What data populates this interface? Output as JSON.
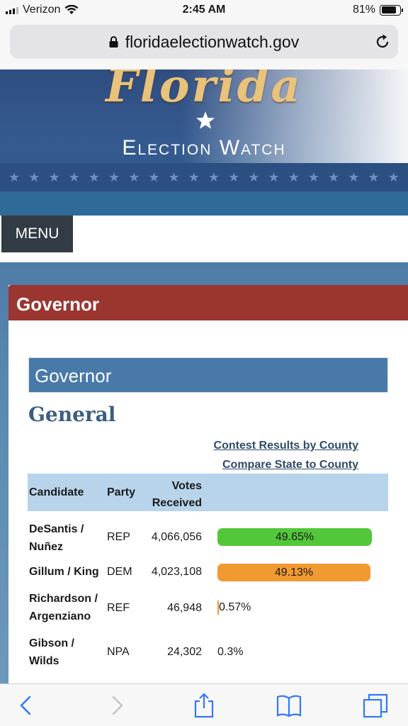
{
  "status_bar": {
    "carrier": "Verizon",
    "time": "2:45 AM",
    "battery_text": "81%",
    "battery_level": 0.81
  },
  "browser": {
    "url": "floridaelectionwatch.gov"
  },
  "banner": {
    "title": "Florida",
    "subtitle": "Election Watch"
  },
  "menu": {
    "label": "MENU"
  },
  "contest": {
    "card_title": "Governor",
    "section_title": "Governor",
    "election_type": "General",
    "links": [
      "Contest Results by County",
      "Compare State to County"
    ],
    "columns": {
      "candidate": "Candidate",
      "party": "Party",
      "votes_line1": "Votes",
      "votes_line2": "Received"
    },
    "candidates": [
      {
        "name_line1": "DeSantis /",
        "name_line2": "Nuñez",
        "party": "REP",
        "votes": "4,066,056",
        "percent": "49.65%",
        "share": 49.65,
        "color": "#52c73a"
      },
      {
        "name_line1": "Gillum / King",
        "name_line2": "",
        "party": "DEM",
        "votes": "4,023,108",
        "percent": "49.13%",
        "share": 49.13,
        "color": "#f29a32"
      },
      {
        "name_line1": "Richardson /",
        "name_line2": "Argenziano",
        "party": "REF",
        "votes": "46,948",
        "percent": "0.57%",
        "share": 0.57,
        "color": "#f29a32"
      },
      {
        "name_line1": "Gibson /",
        "name_line2": "Wilds",
        "party": "NPA",
        "votes": "24,302",
        "percent": "0.3%",
        "share": 0.3,
        "color": ""
      }
    ]
  },
  "toolbar": {
    "icons": [
      "back-icon",
      "forward-icon",
      "share-icon",
      "bookmarks-icon",
      "tabs-icon"
    ]
  }
}
